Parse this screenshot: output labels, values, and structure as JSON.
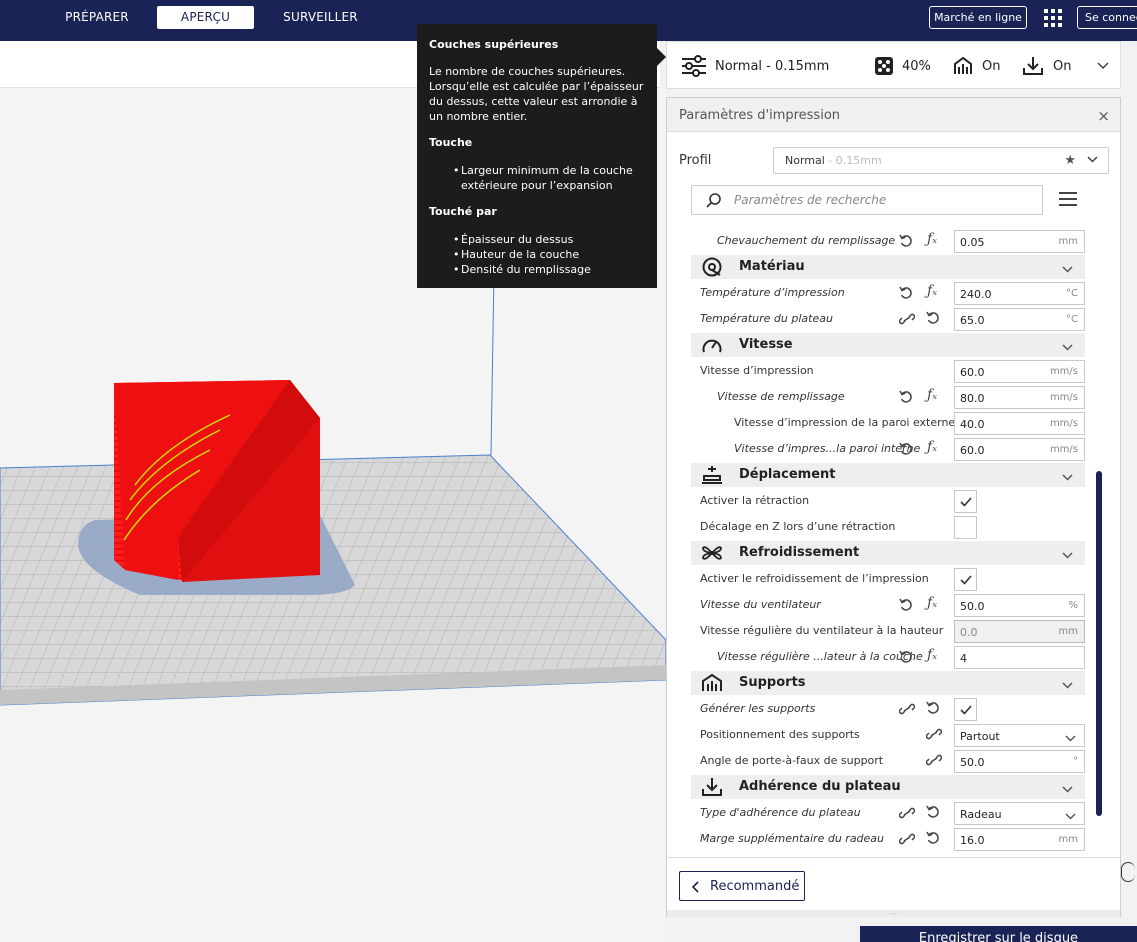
{
  "topbar": {
    "tabs": [
      "PRÉPARER",
      "APERÇU",
      "SURVEILLER"
    ],
    "active_tab": "APERÇU",
    "market_label": "Marché en ligne",
    "connect_label": "Se connecter"
  },
  "summary": {
    "profile": "Normal - 0.15mm",
    "infill": "40%",
    "support": "On",
    "adhesion": "On"
  },
  "tooltip": {
    "title": "Couches supérieures",
    "body": "Le nombre de couches supérieures. Lorsqu’elle est calculée par l’épaisseur du dessus, cette valeur est arrondie à un nombre entier.",
    "affects_title": "Touche",
    "affects": [
      "Largeur minimum de la couche extérieure pour l’expansion"
    ],
    "affected_by_title": "Touché par",
    "affected_by": [
      "Épaisseur du dessus",
      "Hauteur de la couche",
      "Densité du remplissage"
    ]
  },
  "panel": {
    "title": "Paramètres d'impression",
    "profile_label": "Profil",
    "profile_name": "Normal",
    "profile_sub": " - 0.15mm",
    "search_placeholder": "Paramètres de recherche",
    "recommended_label": "Recommandé",
    "resize_glyph": "...",
    "rows": [
      {
        "type": "setting",
        "label": "Chevauchement du remplissage",
        "italic": true,
        "indent": 2,
        "icons": [
          "reset",
          "fx"
        ],
        "value": "0.05",
        "unit": "mm"
      },
      {
        "type": "category",
        "label": "Matériau",
        "icon": "material-icon"
      },
      {
        "type": "setting",
        "label": "Température d’impression",
        "italic": true,
        "indent": 1,
        "icons": [
          "reset",
          "fx"
        ],
        "value": "240.0",
        "unit": "°C"
      },
      {
        "type": "setting",
        "label": "Température du plateau",
        "italic": true,
        "indent": 1,
        "icons": [
          "link",
          "reset"
        ],
        "value": "65.0",
        "unit": "°C"
      },
      {
        "type": "category",
        "label": "Vitesse",
        "icon": "speed-icon"
      },
      {
        "type": "setting",
        "label": "Vitesse d’impression",
        "italic": false,
        "indent": 1,
        "icons": [],
        "value": "60.0",
        "unit": "mm/s"
      },
      {
        "type": "setting",
        "label": "Vitesse de remplissage",
        "italic": true,
        "indent": 2,
        "icons": [
          "reset",
          "fx"
        ],
        "value": "80.0",
        "unit": "mm/s"
      },
      {
        "type": "setting",
        "label": "Vitesse d’impression de la paroi externe",
        "italic": false,
        "indent": 3,
        "icons": [],
        "value": "40.0",
        "unit": "mm/s"
      },
      {
        "type": "setting",
        "label": "Vitesse d’impres...la paroi interne",
        "italic": true,
        "indent": 3,
        "icons": [
          "reset",
          "fx"
        ],
        "value": "60.0",
        "unit": "mm/s"
      },
      {
        "type": "category",
        "label": "Déplacement",
        "icon": "travel-icon"
      },
      {
        "type": "check",
        "label": "Activer la rétraction",
        "italic": false,
        "indent": 1,
        "icons": [],
        "checked": true
      },
      {
        "type": "check",
        "label": "Décalage en Z lors d’une rétraction",
        "italic": false,
        "indent": 1,
        "icons": [],
        "checked": false
      },
      {
        "type": "category",
        "label": "Refroidissement",
        "icon": "fan-icon"
      },
      {
        "type": "check",
        "label": "Activer le refroidissement de l’impression",
        "italic": false,
        "indent": 1,
        "icons": [],
        "checked": true
      },
      {
        "type": "setting",
        "label": "Vitesse du ventilateur",
        "italic": true,
        "indent": 1,
        "icons": [
          "reset",
          "fx"
        ],
        "value": "50.0",
        "unit": "%"
      },
      {
        "type": "setting",
        "label": "Vitesse régulière du ventilateur à la hauteur",
        "italic": false,
        "indent": 1,
        "icons": [],
        "value": "0.0",
        "unit": "mm",
        "disabled": true
      },
      {
        "type": "setting",
        "label": "Vitesse régulière ...lateur à la couche",
        "italic": true,
        "indent": 2,
        "icons": [
          "reset",
          "fx"
        ],
        "value": "4",
        "unit": ""
      },
      {
        "type": "category",
        "label": "Supports",
        "icon": "support-icon"
      },
      {
        "type": "check",
        "label": "Générer les supports",
        "italic": true,
        "indent": 1,
        "icons": [
          "link",
          "reset"
        ],
        "checked": true
      },
      {
        "type": "select",
        "label": "Positionnement des supports",
        "italic": false,
        "indent": 1,
        "icons": [
          "link"
        ],
        "value": "Partout"
      },
      {
        "type": "setting",
        "label": "Angle de porte-à-faux de support",
        "italic": false,
        "indent": 1,
        "icons": [
          "link"
        ],
        "value": "50.0",
        "unit": "°"
      },
      {
        "type": "category",
        "label": "Adhérence du plateau",
        "icon": "adhesion-icon"
      },
      {
        "type": "select",
        "label": "Type d'adhérence du plateau",
        "italic": true,
        "indent": 1,
        "icons": [
          "link",
          "reset"
        ],
        "value": "Radeau"
      },
      {
        "type": "setting",
        "label": "Marge supplémentaire du radeau",
        "italic": true,
        "indent": 1,
        "icons": [
          "link",
          "reset"
        ],
        "value": "16.0",
        "unit": "mm"
      }
    ]
  },
  "save_label": "Enregistrer sur le disque",
  "colors": {
    "brand": "#1a2356",
    "model": "#ff1a1a",
    "build_plate": "#c8c8c8",
    "raft_shadow": "#8fa3c4"
  }
}
